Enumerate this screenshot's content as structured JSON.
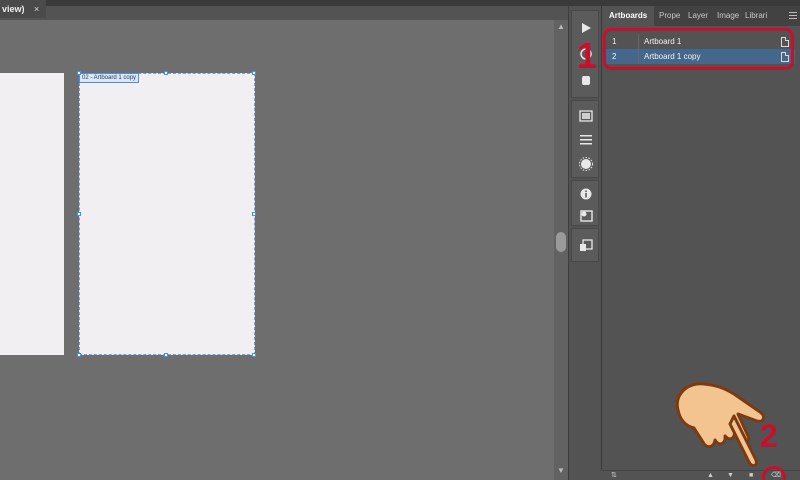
{
  "document": {
    "tab_title": "view)",
    "tab_close": "×"
  },
  "canvas": {
    "artboard_label": "02 - Artboard 1 copy"
  },
  "panel": {
    "tabs": [
      {
        "label": "Artboards",
        "active": true
      },
      {
        "label": "Prope",
        "active": false
      },
      {
        "label": "Layer",
        "active": false
      },
      {
        "label": "Image",
        "active": false
      },
      {
        "label": "Librari",
        "active": false
      }
    ],
    "artboards": [
      {
        "number": "1",
        "name": "Artboard 1",
        "selected": false
      },
      {
        "number": "2",
        "name": "Artboard 1 copy",
        "selected": true
      }
    ]
  },
  "annotations": {
    "step_1": "1",
    "step_2": "2",
    "color": "#c8102e"
  },
  "colors": {
    "canvas": "#6e6e6e",
    "artboard": "#f1eff1",
    "selection": "#45678c",
    "panel": "#535353"
  }
}
